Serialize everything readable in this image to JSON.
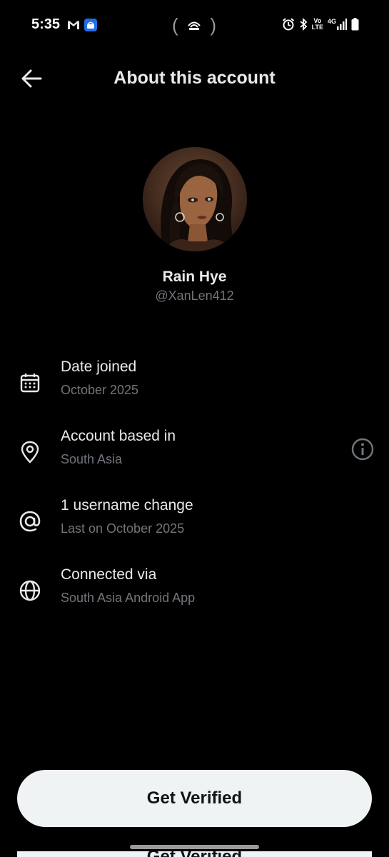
{
  "status_bar": {
    "time": "5:35",
    "left_icons": [
      "gmail-icon",
      "app-notification-icon"
    ],
    "center_icon": "hotspot-icon",
    "right_icons": [
      "alarm-icon",
      "bluetooth-icon",
      "volte-icon",
      "signal-4g-icon",
      "battery-icon"
    ],
    "volte_top": "Vo",
    "volte_bottom": "LTE",
    "network": "4G"
  },
  "header": {
    "title": "About this account",
    "back_icon": "arrow-left-icon"
  },
  "profile": {
    "display_name": "Rain Hye",
    "handle": "@XanLen412"
  },
  "info_rows": [
    {
      "icon": "calendar-icon",
      "label": "Date joined",
      "value": "October 2025"
    },
    {
      "icon": "location-pin-icon",
      "label": "Account based in",
      "value": "South Asia",
      "has_info": true
    },
    {
      "icon": "at-sign-icon",
      "label": "1 username change",
      "value": "Last on October 2025"
    },
    {
      "icon": "globe-icon",
      "label": "Connected via",
      "value": "South Asia Android App"
    }
  ],
  "cta": {
    "label": "Get Verified"
  },
  "colors": {
    "background": "#000000",
    "primary_text": "#e7e9ea",
    "secondary_text": "#71767b",
    "button_bg": "#eff3f4",
    "button_text": "#0f1419"
  }
}
